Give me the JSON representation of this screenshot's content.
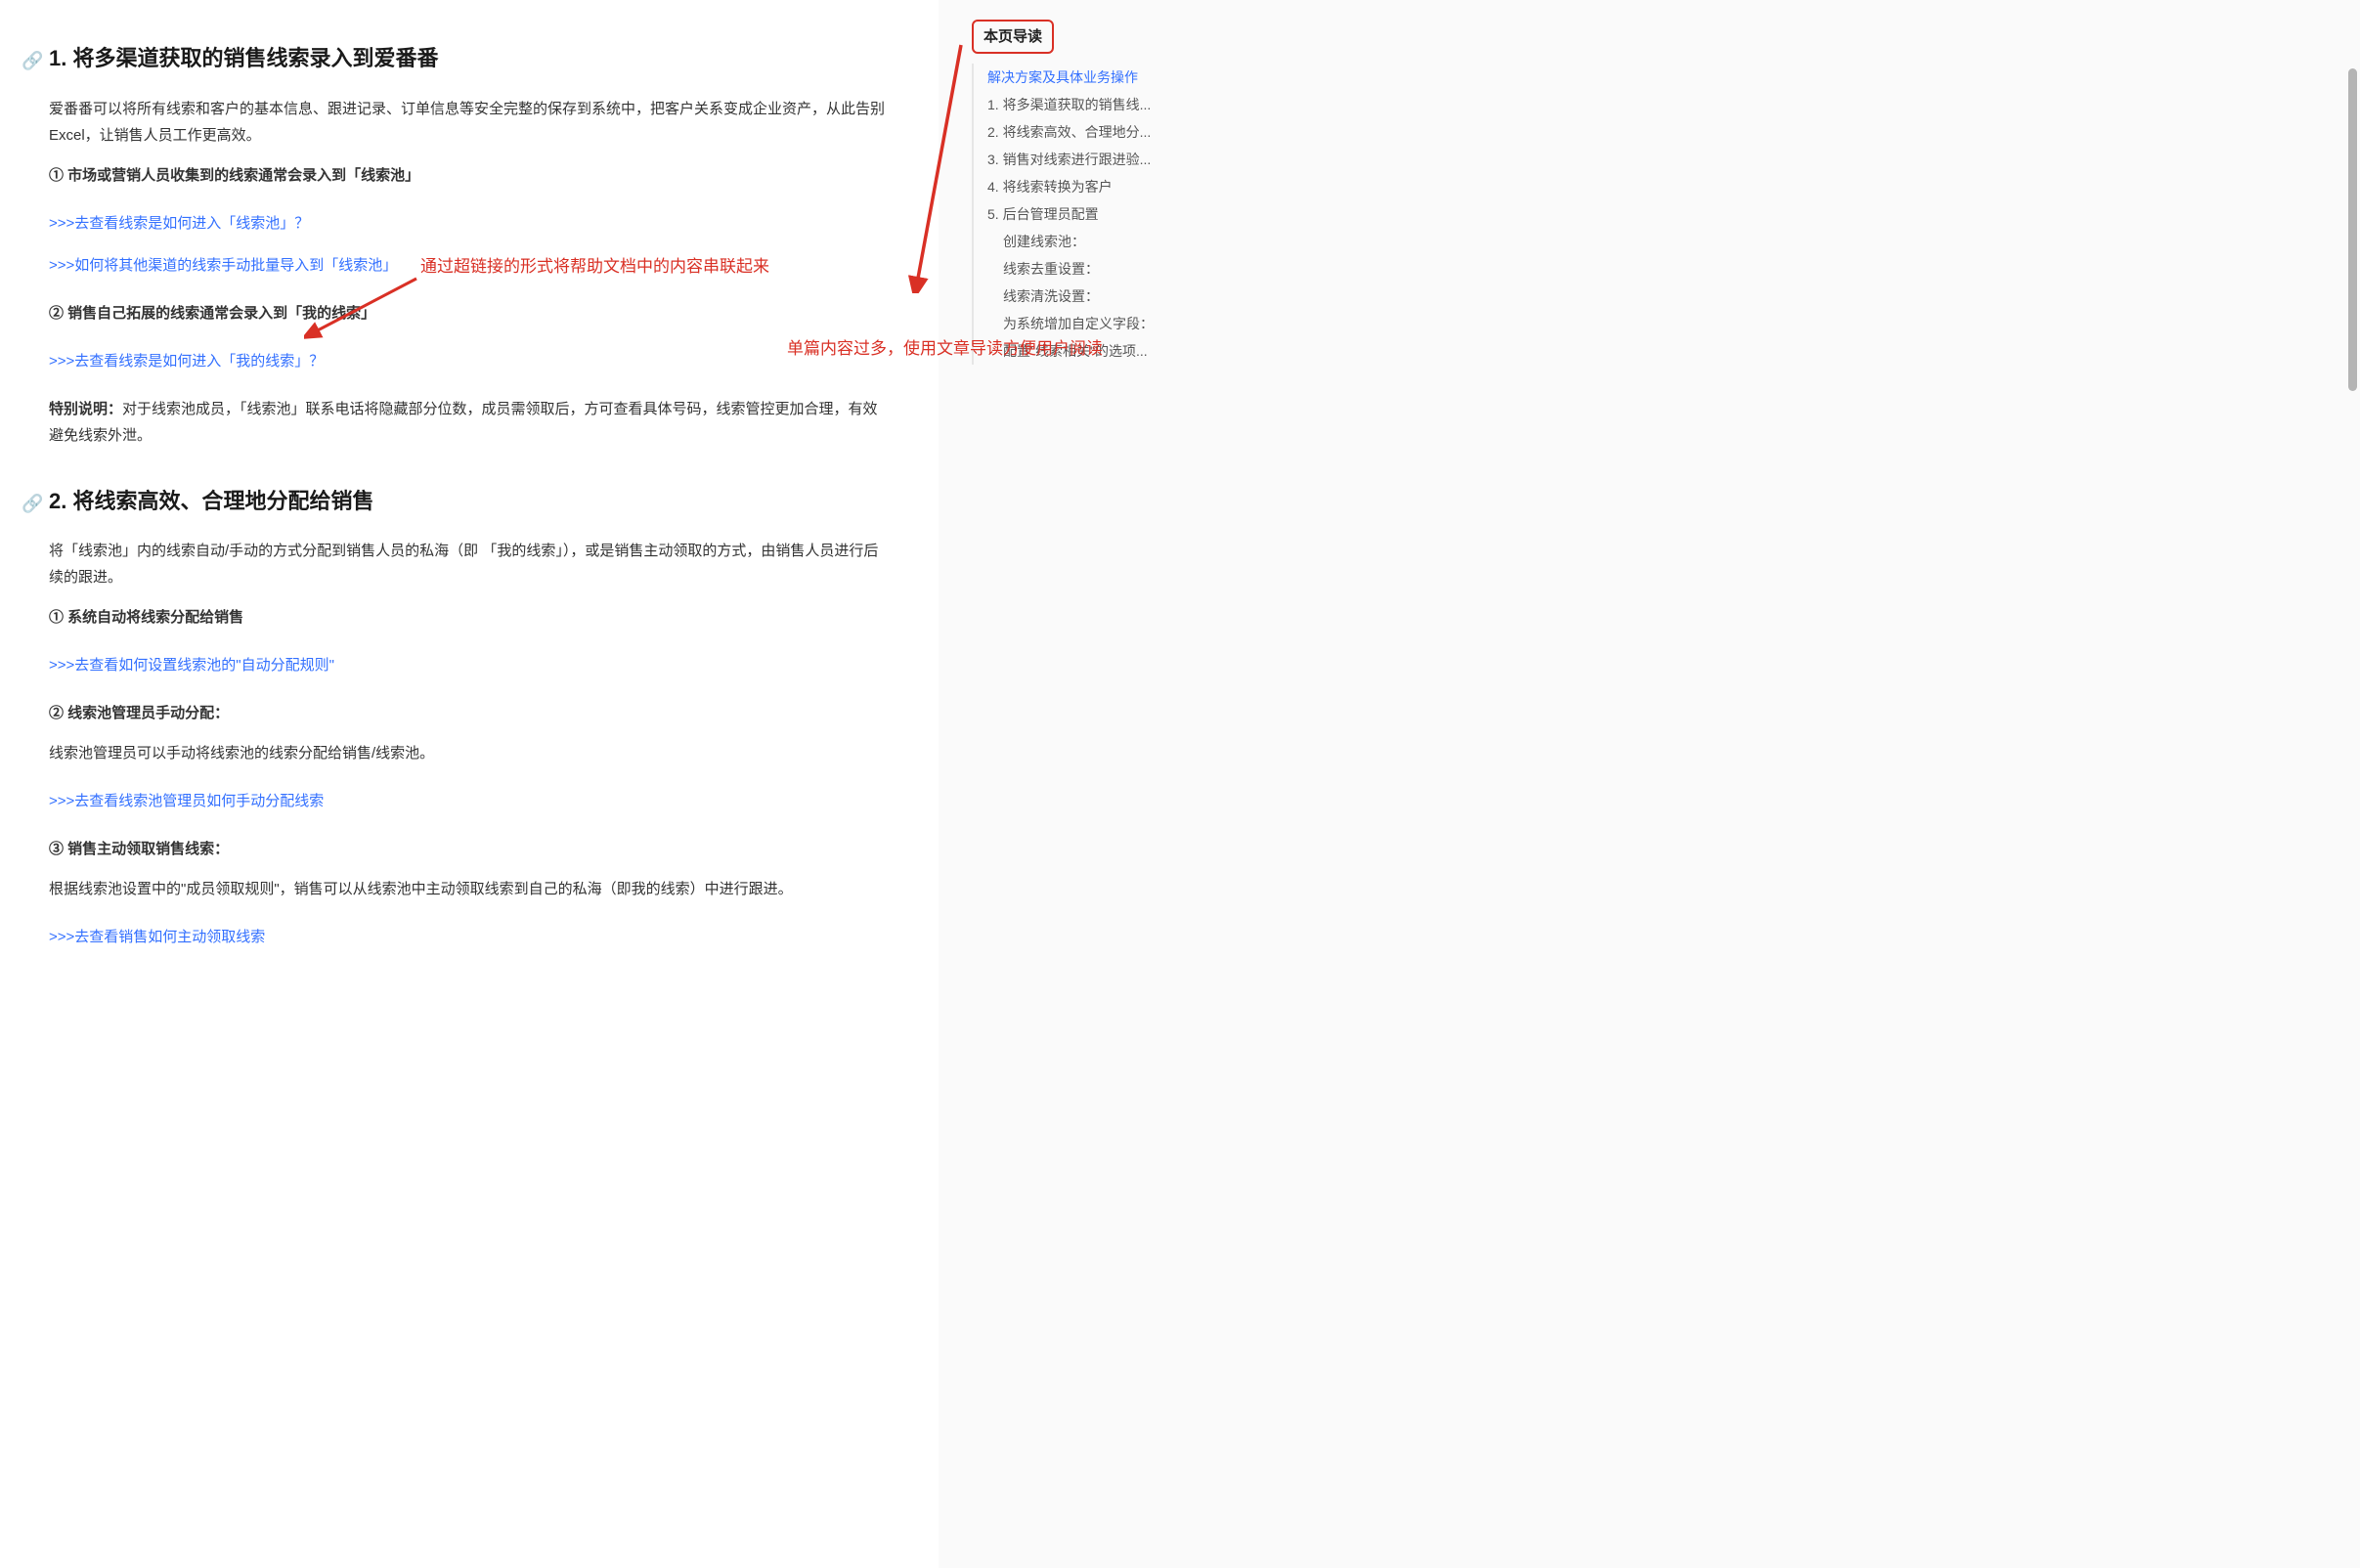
{
  "main": {
    "section1": {
      "heading": "1. 将多渠道获取的销售线索录入到爱番番",
      "intro": "爱番番可以将所有线索和客户的基本信息、跟进记录、订单信息等安全完整的保存到系统中，把客户关系变成企业资产，从此告别Excel，让销售人员工作更高效。",
      "sub1": "① 市场或营销人员收集到的线索通常会录入到「线索池」",
      "link1": ">>>去查看线索是如何进入「线索池」？",
      "link2": ">>>如何将其他渠道的线索手动批量导入到「线索池」",
      "sub2": "② 销售自己拓展的线索通常会录入到「我的线索」",
      "link3": ">>>去查看线索是如何进入「我的线索」？",
      "note_label": "特别说明：",
      "note_text": "对于线索池成员，「线索池」联系电话将隐藏部分位数，成员需领取后，方可查看具体号码，线索管控更加合理，有效避免线索外泄。"
    },
    "section2": {
      "heading": "2. 将线索高效、合理地分配给销售",
      "intro": "将「线索池」内的线索自动/手动的方式分配到销售人员的私海（即 「我的线索」），或是销售主动领取的方式，由销售人员进行后续的跟进。",
      "sub1": "① 系统自动将线索分配给销售",
      "link1": ">>>去查看如何设置线索池的\"自动分配规则\"",
      "sub2": "② 线索池管理员手动分配：",
      "text2": "线索池管理员可以手动将线索池的线索分配给销售/线索池。",
      "link2": ">>>去查看线索池管理员如何手动分配线索",
      "sub3": "③ 销售主动领取销售线索：",
      "text3": "根据线索池设置中的\"成员领取规则\"，销售可以从线索池中主动领取线索到自己的私海（即我的线索）中进行跟进。",
      "link3": ">>>去查看销售如何主动领取线索"
    },
    "annotation1": "通过超链接的形式将帮助文档中的内容串联起来"
  },
  "toc": {
    "title": "本页导读",
    "items": [
      {
        "label": "解决方案及具体业务操作",
        "active": true,
        "sub": false
      },
      {
        "label": "1. 将多渠道获取的销售线...",
        "active": false,
        "sub": false
      },
      {
        "label": "2. 将线索高效、合理地分...",
        "active": false,
        "sub": false
      },
      {
        "label": "3. 销售对线索进行跟进验...",
        "active": false,
        "sub": false
      },
      {
        "label": "4. 将线索转换为客户",
        "active": false,
        "sub": false
      },
      {
        "label": "5. 后台管理员配置",
        "active": false,
        "sub": false
      },
      {
        "label": "创建线索池：",
        "active": false,
        "sub": true
      },
      {
        "label": "线索去重设置：",
        "active": false,
        "sub": true
      },
      {
        "label": "线索清洗设置：",
        "active": false,
        "sub": true
      },
      {
        "label": "为系统增加自定义字段：",
        "active": false,
        "sub": true
      },
      {
        "label": "配置\"线索相关\"的选项...",
        "active": false,
        "sub": true
      }
    ],
    "annotation": "单篇内容过多，使用文章导读方便用户阅读"
  }
}
